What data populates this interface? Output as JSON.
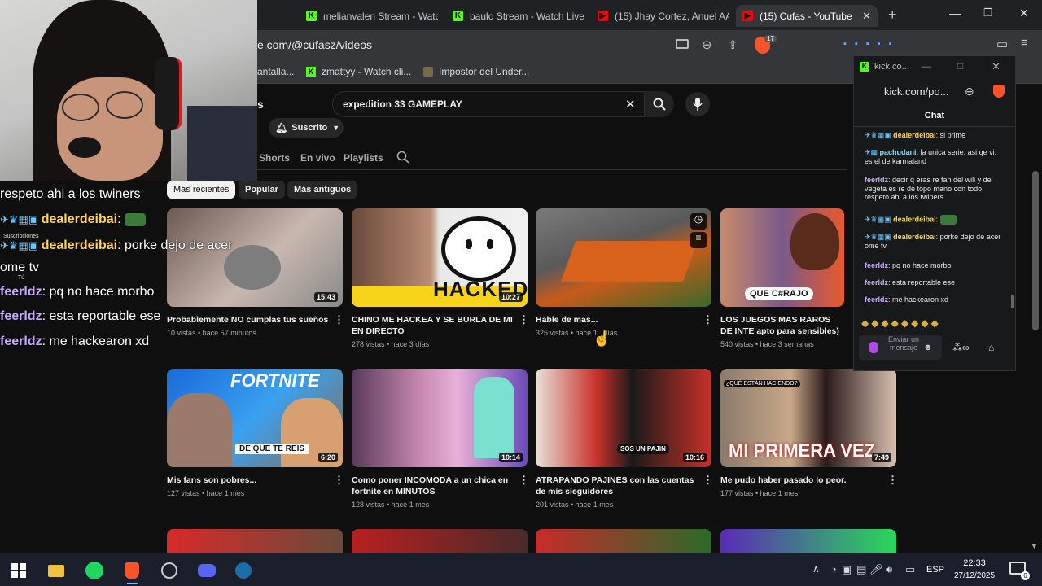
{
  "browser": {
    "tabs": [
      {
        "title": "melianvalen Stream - Watc",
        "kind": "kick"
      },
      {
        "title": "baulo Stream - Watch Live",
        "kind": "kick"
      },
      {
        "title": "(15) Jhay Cortez, Anuel AA",
        "kind": "yt"
      },
      {
        "title": "(15) Cufas - YouTube",
        "kind": "yt",
        "active": true
      }
    ],
    "new_tab": "+",
    "url": "e.com/@cufasz/videos",
    "brave_badge": "17",
    "bookmarks": [
      "antalla...",
      "zmattyy - Watch cli...",
      "Impostor del Under..."
    ]
  },
  "youtube": {
    "channel_fragment": "s",
    "search_value": "expedition 33 GAMEPLAY",
    "subscribed_label": "Suscrito",
    "nav_tabs": [
      "Shorts",
      "En vivo",
      "Playlists"
    ],
    "chips": [
      "Más recientes",
      "Popular",
      "Más antiguos"
    ],
    "videos": [
      {
        "title": "Probablemente NO cumplas tus sueños",
        "meta": "10 vistas • hace 57 minutos",
        "duration": "15:43"
      },
      {
        "title": "CHINO ME HACKEA Y SE BURLA DE MI EN DIRECTO",
        "meta": "278 vistas • hace 3 días",
        "duration": "10:27",
        "thumb_text": "HACKED"
      },
      {
        "title": "Hable de mas...",
        "meta": "325 vistas • hace 1_ días",
        "duration": ""
      },
      {
        "title": "LOS JUEGOS MAS RAROS DE INTE apto para sensibles)",
        "meta": "540 vistas • hace 3 semanas",
        "duration": "",
        "thumb_text": "QUE C#RAJO"
      },
      {
        "title": "Mis fans son pobres...",
        "meta": "127 vistas • hace 1 mes",
        "duration": "6:20",
        "thumb_text": "FORTNITE",
        "thumb_text2": "DE QUE TE REIS"
      },
      {
        "title": "Como poner INCOMODA a un chica en fortnite en MINUTOS",
        "meta": "128 vistas • hace 1 mes",
        "duration": "10:14"
      },
      {
        "title": "ATRAPANDO PAJINES con las cuentas de mis sieguidores",
        "meta": "201 vistas • hace 1 mes",
        "duration": "10:16",
        "thumb_text": "SOS UN PAJIN"
      },
      {
        "title": "Me pudo haber pasado lo peor.",
        "meta": "177 vistas • hace 1 mes",
        "duration": "7:49",
        "thumb_text": "MI PRIMERA VEZ",
        "thumb_text2": "¿QUÉ ESTÁN HACIENDO?"
      }
    ]
  },
  "overlay_chat": {
    "lines": [
      {
        "name": "",
        "text": "respeto ahi a los twiners"
      },
      {
        "name": "dealerdeibai",
        "text": ":"
      },
      {
        "name": "dealerdeibai",
        "text": ": porke dejo de acer"
      },
      {
        "name": "",
        "text": "ome tv"
      },
      {
        "name": "feerldz",
        "text": ": pq no hace morbo"
      },
      {
        "name": "feerldz",
        "text": ": esta reportable ese"
      },
      {
        "name": "feerldz",
        "text": ": me hackearon xd"
      }
    ],
    "small_label": "Suscripciones",
    "tu_label": "Tú",
    "name_color": "#c8a8ff"
  },
  "kick_popup": {
    "title": "kick.co...",
    "address": "kick.com/po...",
    "header": "Chat",
    "messages": [
      {
        "user": "dealerdeibai",
        "color": "#ffd54a",
        "text": ": si prime"
      },
      {
        "user": "pachudani",
        "color": "#7ee0ff",
        "text": ": la unica serie. asi qe vi. es el de karmaland"
      },
      {
        "user": "feerldz",
        "color": "#c8a8ff",
        "text": ": decir q eras re fan del wili y del vegeta es re de topo mano con todo respeto ahi a los twiners"
      },
      {
        "user": "dealerdeibai",
        "color": "#ffd54a",
        "text": ":"
      },
      {
        "user": "dealerdeibai",
        "color": "#ffd54a",
        "text": ": porke dejo de acer ome tv"
      },
      {
        "user": "feerldz",
        "color": "#c8a8ff",
        "text": ": pq no hace morbo"
      },
      {
        "user": "feerldz",
        "color": "#c8a8ff",
        "text": ": esta reportable ese"
      },
      {
        "user": "feerldz",
        "color": "#c8a8ff",
        "text": ": me hackearon xd"
      }
    ],
    "send_placeholder": "Enviar un mensaje"
  },
  "taskbar": {
    "lang": "ESP",
    "time": "22:33",
    "date": "27/12/2025",
    "notif_count": "6"
  }
}
